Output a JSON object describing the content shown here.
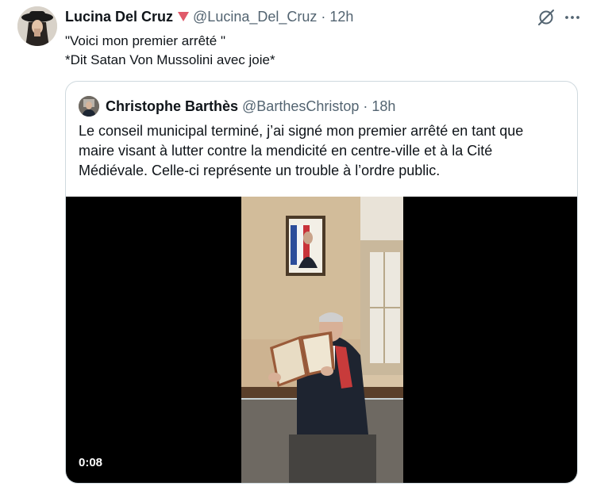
{
  "tweet": {
    "display_name": "Lucina Del Cruz",
    "handle": "@Lucina_Del_Cruz",
    "separator": "·",
    "time": "12h",
    "text_lines": [
      "\"Voici mon premier arrêté \"",
      "*Dit Satan Von Mussolini avec joie*"
    ],
    "icons": {
      "badge": "heart-icon",
      "grok": "grok-icon",
      "more": "more-icon"
    },
    "badge_color": "#e05a6a"
  },
  "quote": {
    "display_name": "Christophe Barthès",
    "handle": "@BarthesChristop",
    "separator": "·",
    "time": "18h",
    "text_lines": [
      "Le conseil municipal terminé, j’ai signé mon premier arrêté en tant que",
      "maire visant à lutter contre la mendicité en centre-ville et à la Cité",
      "Médiévale. Celle-ci représente un trouble à l’ordre public."
    ],
    "video": {
      "duration": "0:08"
    }
  }
}
